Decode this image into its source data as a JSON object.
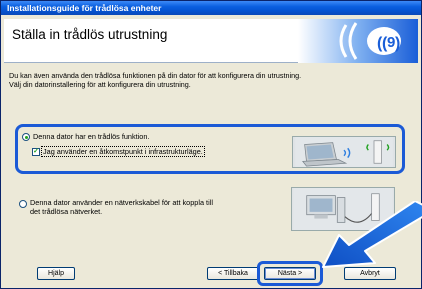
{
  "window": {
    "title": "Installationsguide för trådlösa enheter"
  },
  "banner": {
    "heading": "Ställa in trådlös utrustning"
  },
  "intro": {
    "line1": "Du kan även använda den trådlösa funktionen på din dator för att konfigurera din utrustning.",
    "line2": "Välj din datorinstallering för att konfigurera din utrustning."
  },
  "options": {
    "wireless": {
      "label": "Denna dator har en trådlös funktion.",
      "selected": true,
      "access_point": {
        "label": "Jag använder en åtkomstpunkt i infrastrukturläge.",
        "checked": true
      }
    },
    "cable": {
      "label_line1": "Denna dator använder en nätverkskabel för att koppla till",
      "label_line2": "det trådlösa nätverket.",
      "selected": false
    }
  },
  "buttons": {
    "help": "Hjälp",
    "back": "< Tillbaka",
    "next": "Nästa >",
    "cancel": "Avbryt"
  },
  "colors": {
    "titlebar": "#0a5fe0",
    "highlight": "#1b5ad6",
    "arrow": "#1f6fe0"
  },
  "icons": {
    "logo": "wireless-logo-icon",
    "pointer": "arrow-pointer-icon"
  }
}
